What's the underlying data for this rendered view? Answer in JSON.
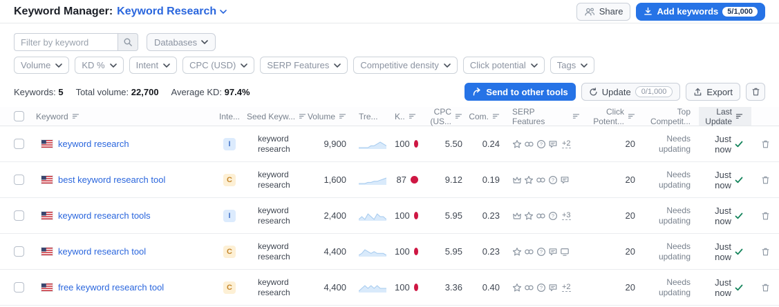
{
  "header": {
    "title": "Keyword Manager:",
    "list_name": "Keyword Research",
    "share_label": "Share",
    "add_keywords_label": "Add keywords",
    "add_keywords_count": "5/1,000"
  },
  "filter_bar": {
    "search_placeholder": "Filter by keyword",
    "databases_label": "Databases",
    "chips": [
      "Volume",
      "KD %",
      "Intent",
      "CPC (USD)",
      "SERP Features",
      "Competitive density",
      "Click potential",
      "Tags"
    ]
  },
  "summary": {
    "keywords_label": "Keywords:",
    "keywords_value": "5",
    "total_volume_label": "Total volume:",
    "total_volume_value": "22,700",
    "average_kd_label": "Average KD:",
    "average_kd_value": "97.4%"
  },
  "actions": {
    "send_label": "Send to other tools",
    "update_label": "Update",
    "update_count": "0/1,000",
    "export_label": "Export"
  },
  "table": {
    "columns": [
      {
        "id": "checkbox",
        "label": "",
        "sortable": false
      },
      {
        "id": "keyword",
        "label": "Keyword",
        "sortable": true
      },
      {
        "id": "intent",
        "label": "Inte...",
        "sortable": false
      },
      {
        "id": "seed",
        "label": "Seed Keyw...",
        "sortable": true
      },
      {
        "id": "volume",
        "label": "Volume",
        "sortable": true
      },
      {
        "id": "trend",
        "label": "Tre...",
        "sortable": false
      },
      {
        "id": "kd",
        "label": "K..",
        "sortable": true
      },
      {
        "id": "cpc",
        "label": "CPC (US...",
        "sortable": true
      },
      {
        "id": "com",
        "label": "Com.",
        "sortable": true
      },
      {
        "id": "serp",
        "label": "SERP Features",
        "sortable": true
      },
      {
        "id": "click",
        "label": "Click Potent...",
        "sortable": true
      },
      {
        "id": "top",
        "label": "Top Competit...",
        "sortable": false
      },
      {
        "id": "last",
        "label": "Last Update",
        "sortable": true,
        "sorted": true
      },
      {
        "id": "del",
        "label": "",
        "sortable": false
      }
    ],
    "rows": [
      {
        "keyword": "keyword research",
        "intent": "I",
        "seed": "keyword research",
        "volume": "9,900",
        "trend": [
          2,
          2,
          2,
          2,
          3,
          3,
          4,
          5,
          4,
          3
        ],
        "kd": "100",
        "cpc": "5.50",
        "com": "0.24",
        "serp_features": [
          "star",
          "link",
          "question",
          "chat"
        ],
        "serp_more": "+2",
        "click_potential": "20",
        "top_competitors": "Needs updating",
        "last_update": "Just now"
      },
      {
        "keyword": "best keyword research tool",
        "intent": "C",
        "seed": "keyword research",
        "volume": "1,600",
        "trend": [
          1,
          1,
          1,
          2,
          2,
          3,
          3,
          4,
          5,
          6
        ],
        "kd": "87",
        "cpc": "9.12",
        "com": "0.19",
        "serp_features": [
          "crown",
          "star",
          "link",
          "question",
          "chat"
        ],
        "serp_more": "",
        "click_potential": "20",
        "top_competitors": "Needs updating",
        "last_update": "Just now"
      },
      {
        "keyword": "keyword research tools",
        "intent": "I",
        "seed": "keyword research",
        "volume": "2,400",
        "trend": [
          4,
          5,
          4,
          6,
          5,
          4,
          6,
          5,
          5,
          4
        ],
        "kd": "100",
        "cpc": "5.95",
        "com": "0.23",
        "serp_features": [
          "crown",
          "star",
          "link",
          "question"
        ],
        "serp_more": "+3",
        "click_potential": "20",
        "top_competitors": "Needs updating",
        "last_update": "Just now"
      },
      {
        "keyword": "keyword research tool",
        "intent": "C",
        "seed": "keyword research",
        "volume": "4,400",
        "trend": [
          3,
          4,
          6,
          5,
          4,
          5,
          4,
          4,
          4,
          3
        ],
        "kd": "100",
        "cpc": "5.95",
        "com": "0.23",
        "serp_features": [
          "star",
          "link",
          "question",
          "chat",
          "display"
        ],
        "serp_more": "",
        "click_potential": "20",
        "top_competitors": "Needs updating",
        "last_update": "Just now"
      },
      {
        "keyword": "free keyword research tool",
        "intent": "C",
        "seed": "keyword research",
        "volume": "4,400",
        "trend": [
          3,
          4,
          5,
          4,
          5,
          4,
          5,
          4,
          4,
          4
        ],
        "kd": "100",
        "cpc": "3.36",
        "com": "0.40",
        "serp_features": [
          "star",
          "link",
          "question",
          "chat"
        ],
        "serp_more": "+2",
        "click_potential": "20",
        "top_competitors": "Needs updating",
        "last_update": "Just now"
      }
    ]
  },
  "icons": {
    "share": "two-people",
    "add_keywords": "download-tray",
    "search": "magnifier",
    "chevron": "chevron-down",
    "send": "curved-arrow-right",
    "update": "refresh-arrow",
    "export": "upload-tray",
    "delete": "trash-can",
    "sort": "sort-lines",
    "flag": "us-flag",
    "check": "green-checkmark",
    "star": "star-outline",
    "crown": "crown-outline",
    "link": "chain-links",
    "question": "question-circle",
    "chat": "speech-bubble",
    "display": "monitor"
  },
  "colors": {
    "accent_blue": "#2673e6",
    "link_blue": "#2a66dd",
    "kd_red": "#ce1743",
    "check_green": "#12835a",
    "intent_i_bg": "#dcebfd",
    "intent_i_text": "#4776c9",
    "intent_c_bg": "#fdf0d5",
    "intent_c_text": "#c5872c",
    "sparkline_fill": "#d9eafb",
    "sparkline_line": "#a3c9ee"
  }
}
